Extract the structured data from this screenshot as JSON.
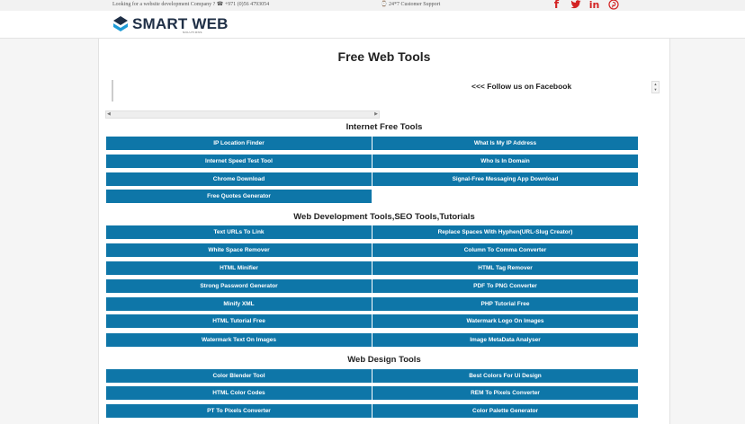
{
  "topbar": {
    "info": "Looking for a website development Company ? ☎ +971 (0)56 4793054",
    "support": "⌚ 24*7 Customer Support",
    "social_icons": [
      "facebook-icon",
      "twitter-icon",
      "linkedin-icon",
      "pinterest-icon"
    ]
  },
  "brand": {
    "name": "SMART WEB",
    "tagline": "SOLUTIONS",
    "accent": "#1f2f46",
    "icon_color": "#1e9bd7"
  },
  "page": {
    "title": "Free Web Tools",
    "facebook_text": "<<< Follow us on Facebook"
  },
  "colors": {
    "button_bg": "#0e76a8",
    "social": "#d32323"
  },
  "sections": [
    {
      "title": "Internet Free Tools",
      "items": [
        "IP Location Finder",
        "What Is My IP Address",
        "Internet Speed Test Tool",
        "Who Is In Domain",
        "Chrome Download",
        "Signal-Free Messaging App Download",
        "Free Quotes Generator"
      ]
    },
    {
      "title": "Web Development Tools,SEO Tools,Tutorials",
      "items": [
        "Text URLs To Link",
        "Replace Spaces With Hyphen(URL-Slug Creator)",
        "White Space Remover",
        "Column To Comma Converter",
        "HTML Minifier",
        "HTML Tag Remover",
        "Strong Password Generator",
        "PDF To PNG Converter",
        "Minify XML",
        "PHP Tutorial Free",
        "HTML Tutorial Free",
        "Watermark Logo On Images",
        "Watermark Text On Images",
        "Image MetaData Analyser"
      ]
    },
    {
      "title": "Web Design Tools",
      "items": [
        "Color Blender Tool",
        "Best Colors For Ui Design",
        "HTML Color Codes",
        "REM To Pixels Converter",
        "PT To Pixels Converter",
        "Color Palette Generator"
      ]
    }
  ]
}
